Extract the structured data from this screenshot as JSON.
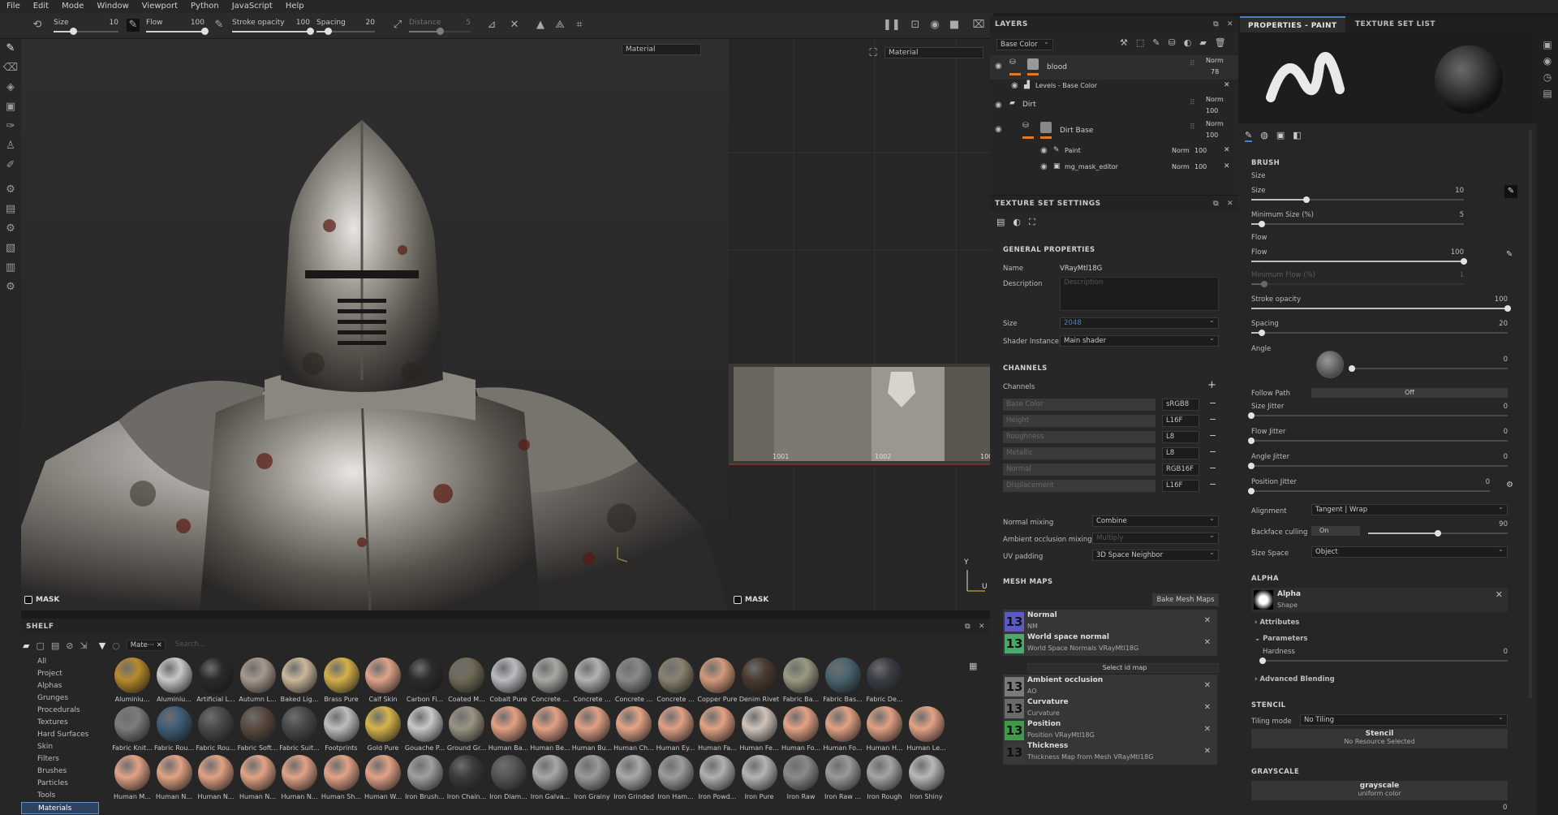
{
  "menu": [
    "File",
    "Edit",
    "Mode",
    "Window",
    "Viewport",
    "Python",
    "JavaScript",
    "Help"
  ],
  "toolbar": {
    "size": {
      "label": "Size",
      "value": "10",
      "level": 0.3
    },
    "flow": {
      "label": "Flow",
      "value": "100",
      "level": 1.0
    },
    "stroke_opacity": {
      "label": "Stroke opacity",
      "value": "100",
      "level": 1.0
    },
    "spacing": {
      "label": "Spacing",
      "value": "20",
      "level": 0.2
    },
    "distance": {
      "label": "Distance",
      "value": "5",
      "level": 0.5
    }
  },
  "viewport": {
    "material_select_3d": "Material",
    "material_select_2d": "Material",
    "mask_label_3d": "MASK",
    "mask_label_2d": "MASK",
    "udim_labels": [
      "1001",
      "1002",
      "100"
    ],
    "axis_y": "Y",
    "axis_u": "U"
  },
  "shelf": {
    "title": "SHELF",
    "filter_tag": "Mate···",
    "search_placeholder": "Search...",
    "categories": [
      "All",
      "Project",
      "Alphas",
      "Grunges",
      "Procedurals",
      "Textures",
      "Hard Surfaces",
      "Skin",
      "Filters",
      "Brushes",
      "Particles",
      "Tools",
      "Materials"
    ],
    "selected_category": "Materials",
    "materials_row1": [
      {
        "name": "Aluminiu...",
        "color": "#b98a2c"
      },
      {
        "name": "Aluminiu...",
        "color": "#c8c8c8"
      },
      {
        "name": "Artificial L...",
        "color": "#2a2a2a"
      },
      {
        "name": "Autumn L...",
        "color": "#a8988c"
      },
      {
        "name": "Baked Lig...",
        "color": "#cbb79a"
      },
      {
        "name": "Brass Pure",
        "color": "#d4b04a"
      },
      {
        "name": "Calf Skin",
        "color": "#e0a38a"
      },
      {
        "name": "Carbon Fi...",
        "color": "#2c2c2c"
      },
      {
        "name": "Coated M...",
        "color": "#706a56"
      },
      {
        "name": "Cobalt Pure",
        "color": "#b9bcc0"
      },
      {
        "name": "Concrete ...",
        "color": "#a8a8a4"
      },
      {
        "name": "Concrete ...",
        "color": "#b2b2b2"
      },
      {
        "name": "Concrete ...",
        "color": "#8a8a8a"
      },
      {
        "name": "Concrete ...",
        "color": "#8b8270"
      },
      {
        "name": "Copper Pure",
        "color": "#d49a7a"
      },
      {
        "name": "Denim Rivet",
        "color": "#4a3a30"
      },
      {
        "name": "Fabric Ba...",
        "color": "#9a9a82"
      },
      {
        "name": "Fabric Bas...",
        "color": "#4a6470"
      },
      {
        "name": "Fabric De...",
        "color": "#3a3e44"
      }
    ],
    "materials_row2": [
      {
        "name": "Fabric Knit...",
        "color": "#7c7c7c"
      },
      {
        "name": "Fabric Rou...",
        "color": "#3e5e78"
      },
      {
        "name": "Fabric Rou...",
        "color": "#4a4a4a"
      },
      {
        "name": "Fabric Soft...",
        "color": "#5a4a40"
      },
      {
        "name": "Fabric Suit...",
        "color": "#4a4a4a"
      },
      {
        "name": "Footprints",
        "color": "#bdbdbd"
      },
      {
        "name": "Gold Pure",
        "color": "#d7b44a"
      },
      {
        "name": "Gouache P...",
        "color": "#c8c8c8"
      },
      {
        "name": "Ground Gr...",
        "color": "#9a9484"
      },
      {
        "name": "Human Ba...",
        "color": "#e3a083"
      },
      {
        "name": "Human Be...",
        "color": "#e2a184"
      },
      {
        "name": "Human Bu...",
        "color": "#e0a085"
      },
      {
        "name": "Human Ch...",
        "color": "#e4a486"
      },
      {
        "name": "Human Ey...",
        "color": "#e0a086"
      },
      {
        "name": "Human Fa...",
        "color": "#e1a284"
      },
      {
        "name": "Human Fe...",
        "color": "#cfc4bc"
      },
      {
        "name": "Human Fo...",
        "color": "#e3a284"
      },
      {
        "name": "Human Fo...",
        "color": "#e2a285"
      },
      {
        "name": "Human H...",
        "color": "#e0a084"
      },
      {
        "name": "Human Le...",
        "color": "#e3a386"
      }
    ],
    "materials_row3": [
      {
        "name": "Human M...",
        "color": "#e2a286"
      },
      {
        "name": "Human N...",
        "color": "#e2a285"
      },
      {
        "name": "Human N...",
        "color": "#e1a285"
      },
      {
        "name": "Human N...",
        "color": "#e2a386"
      },
      {
        "name": "Human N...",
        "color": "#e1a286"
      },
      {
        "name": "Human Sh...",
        "color": "#e3a387"
      },
      {
        "name": "Human W...",
        "color": "#e2a286"
      },
      {
        "name": "Iron Brush...",
        "color": "#a0a0a0"
      },
      {
        "name": "Iron Chain...",
        "color": "#3c3c3c"
      },
      {
        "name": "Iron Diam...",
        "color": "#555555"
      },
      {
        "name": "Iron Galva...",
        "color": "#a8a8a8"
      },
      {
        "name": "Iron Grainy",
        "color": "#9a9a9a"
      },
      {
        "name": "Iron Grinded",
        "color": "#aaaaaa"
      },
      {
        "name": "Iron Ham...",
        "color": "#9c9c9c"
      },
      {
        "name": "Iron Powd...",
        "color": "#b0b0b0"
      },
      {
        "name": "Iron Pure",
        "color": "#b4b4b4"
      },
      {
        "name": "Iron Raw",
        "color": "#8a8a8a"
      },
      {
        "name": "Iron Raw ...",
        "color": "#9a9a9a"
      },
      {
        "name": "Iron Rough",
        "color": "#a4a4a4"
      },
      {
        "name": "Iron Shiny",
        "color": "#b8b8b8"
      }
    ]
  },
  "layers": {
    "title": "LAYERS",
    "channel_select": "Base Color",
    "rows": [
      {
        "name": "blood",
        "blend": "Norm",
        "opacity": "78"
      },
      {
        "name": "Levels - Base Color",
        "blend": "",
        "opacity": ""
      },
      {
        "name": "Dirt",
        "blend": "Norm",
        "opacity": "100"
      },
      {
        "name": "Dirt Base",
        "blend": "Norm",
        "opacity": "100"
      },
      {
        "name": "Paint",
        "blend": "Norm",
        "opacity": "100"
      },
      {
        "name": "mg_mask_editor",
        "blend": "Norm",
        "opacity": "100"
      }
    ]
  },
  "texture_set": {
    "title": "TEXTURE SET SETTINGS",
    "general_title": "GENERAL PROPERTIES",
    "name_label": "Name",
    "name_value": "VRayMtl18G",
    "description_label": "Description",
    "description_placeholder": "Description",
    "size_label": "Size",
    "size_value": "2048",
    "shader_label": "Shader Instance",
    "shader_value": "Main shader",
    "channels_title": "CHANNELS",
    "channels_label": "Channels",
    "channels": [
      {
        "name": "Base Color",
        "format": "sRGB8"
      },
      {
        "name": "Height",
        "format": "L16F"
      },
      {
        "name": "Roughness",
        "format": "L8"
      },
      {
        "name": "Metallic",
        "format": "L8"
      },
      {
        "name": "Normal",
        "format": "RGB16F"
      },
      {
        "name": "Displacement",
        "format": "L16F"
      }
    ],
    "normal_mixing_label": "Normal mixing",
    "normal_mixing_value": "Combine",
    "ao_mixing_label": "Ambient occlusion mixing",
    "ao_mixing_value": "Multiply",
    "uv_padding_label": "UV padding",
    "uv_padding_value": "3D Space Neighbor",
    "mesh_maps_title": "MESH MAPS",
    "bake_button": "Bake Mesh Maps",
    "select_id_map": "Select id map",
    "mesh_maps": [
      {
        "title": "Normal",
        "sub": "NM",
        "color": "#5a5ac8"
      },
      {
        "title": "World space normal",
        "sub": "World Space Normals VRayMtl18G",
        "color": "#4aa86a"
      },
      {
        "title": "Ambient occlusion",
        "sub": "AO",
        "color": "#7a7a7a"
      },
      {
        "title": "Curvature",
        "sub": "Curvature",
        "color": "#6a6a6a"
      },
      {
        "title": "Position",
        "sub": "Position VRayMtl18G",
        "color": "#3f9a4a"
      },
      {
        "title": "Thickness",
        "sub": "Thickness Map from Mesh VRayMtl18G",
        "color": "#3a3a3a"
      }
    ]
  },
  "properties": {
    "tab_active": "PROPERTIES - PAINT",
    "tab_other": "TEXTURE SET LIST",
    "brush_title": "BRUSH",
    "size_group": "Size",
    "size": {
      "label": "Size",
      "value": "10",
      "level": 0.26
    },
    "min_size": {
      "label": "Minimum Size (%)",
      "value": "5",
      "level": 0.05
    },
    "flow_group": "Flow",
    "flow": {
      "label": "Flow",
      "value": "100",
      "level": 1.0
    },
    "min_flow": {
      "label": "Minimum Flow (%)",
      "value": "1",
      "level": 0.06
    },
    "stroke_opacity": {
      "label": "Stroke opacity",
      "value": "100",
      "level": 1.0
    },
    "spacing": {
      "label": "Spacing",
      "value": "20",
      "level": 0.04
    },
    "angle": {
      "label": "Angle",
      "value": "0"
    },
    "follow_path_label": "Follow Path",
    "follow_path_value": "Off",
    "size_jitter": {
      "label": "Size Jitter",
      "value": "0",
      "level": 0.0
    },
    "flow_jitter": {
      "label": "Flow Jitter",
      "value": "0",
      "level": 0.0
    },
    "angle_jitter": {
      "label": "Angle Jitter",
      "value": "0",
      "level": 0.0
    },
    "position_jitter": {
      "label": "Position Jitter",
      "value": "0",
      "level": 0.0
    },
    "alignment_label": "Alignment",
    "alignment_value": "Tangent | Wrap",
    "backface_label": "Backface culling",
    "backface_value": "On",
    "backface_angle": "90",
    "size_space_label": "Size Space",
    "size_space_value": "Object",
    "alpha_title": "ALPHA",
    "alpha_name": "Alpha",
    "alpha_sub": "Shape",
    "attributes_label": "Attributes",
    "parameters_label": "Parameters",
    "hardness": {
      "label": "Hardness",
      "value": "0",
      "level": 0.0
    },
    "advanced_blending": "Advanced Blending",
    "stencil_title": "STENCIL",
    "tiling_label": "Tiling mode",
    "tiling_value": "No Tiling",
    "stencil_name": "Stencil",
    "stencil_sub": "No Resource Selected",
    "grayscale_title": "GRAYSCALE",
    "grayscale_name": "grayscale",
    "grayscale_sub": "uniform color",
    "grayscale_value": "0"
  }
}
